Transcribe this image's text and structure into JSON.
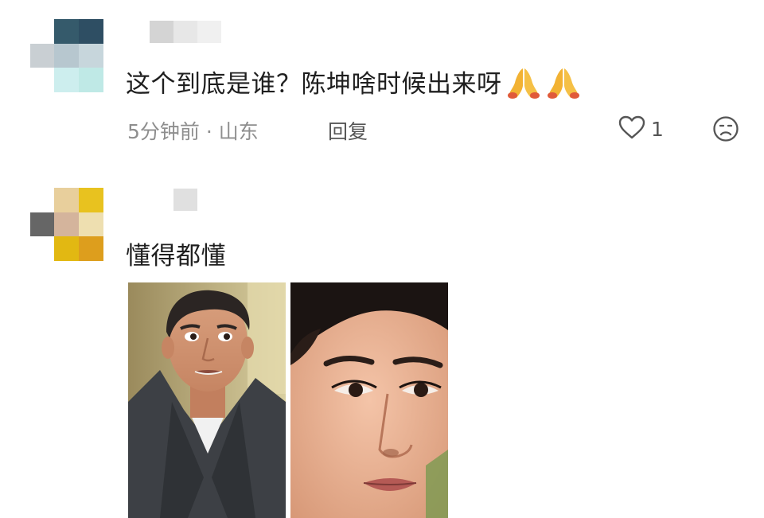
{
  "comments": [
    {
      "text": "这个到底是谁？陈坤啥时候出来呀",
      "emojis": [
        "folded-hands-icon",
        "folded-hands-icon"
      ],
      "time": "5分钟前",
      "separator": "·",
      "location": "山东",
      "reply_label": "回复",
      "like_count": "1"
    },
    {
      "text": "懂得都懂",
      "images": [
        "actor-photo-left",
        "actor-photo-right"
      ]
    }
  ],
  "colors": {
    "text": "#1f1f1f",
    "meta": "#8e8e8e",
    "icon": "#555555"
  }
}
